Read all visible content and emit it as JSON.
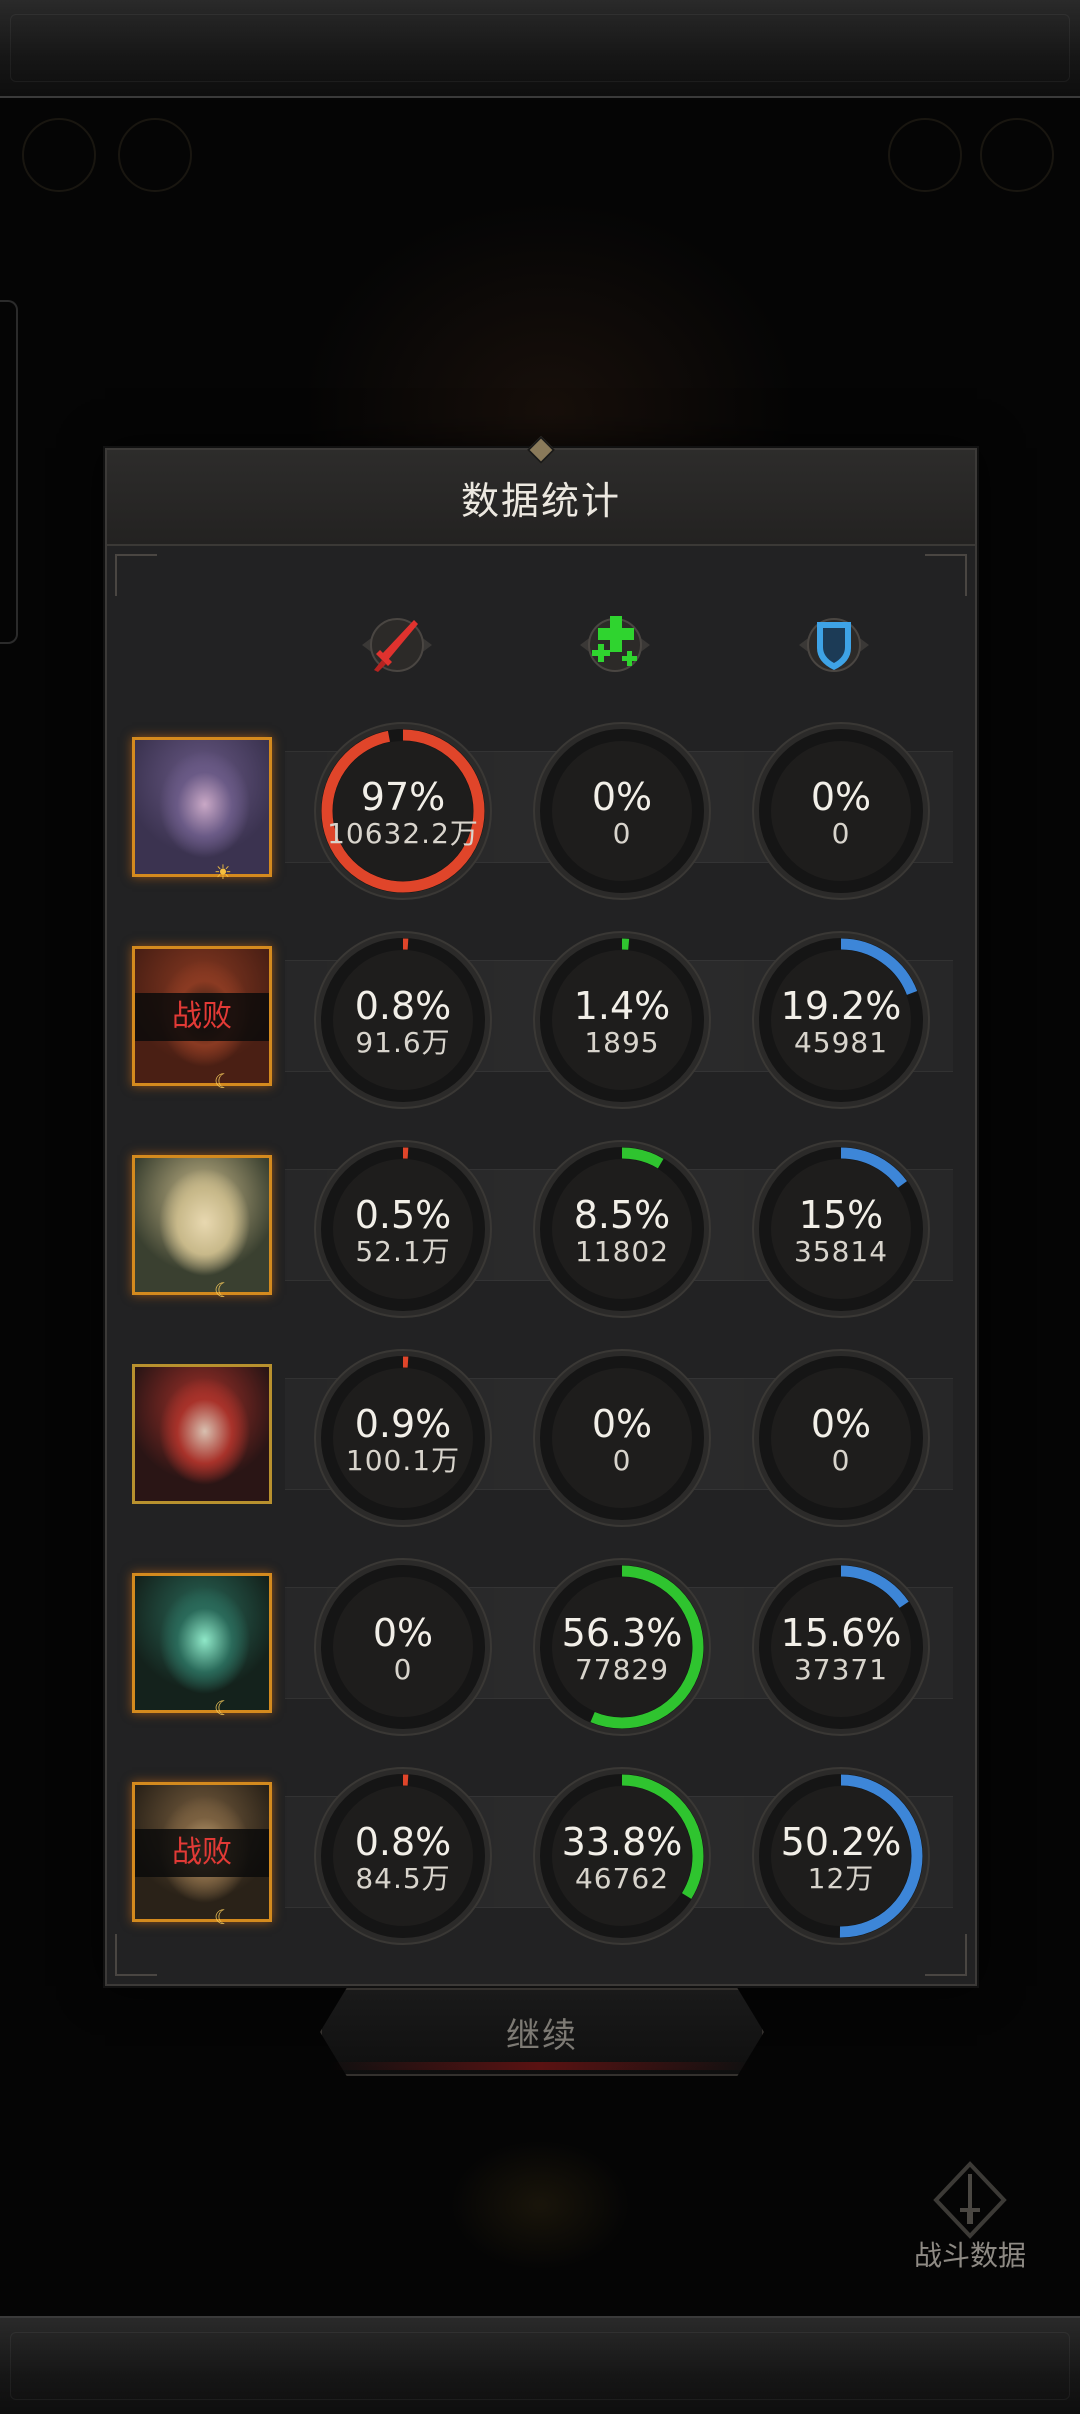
{
  "panel": {
    "title": "数据统计",
    "columns": [
      {
        "icon": "sword-damage-icon",
        "color": "#e0322e"
      },
      {
        "icon": "heal-plus-icon",
        "color": "#2fd42f"
      },
      {
        "icon": "shield-tank-icon",
        "color": "#3ea3e6"
      }
    ],
    "rows": [
      {
        "hero": "hero-1",
        "defeated_label": "",
        "badge": "sun-icon",
        "stats": [
          {
            "pct": "97%",
            "value": "10632.2万",
            "fraction": 0.97
          },
          {
            "pct": "0%",
            "value": "0",
            "fraction": 0
          },
          {
            "pct": "0%",
            "value": "0",
            "fraction": 0
          }
        ]
      },
      {
        "hero": "hero-2",
        "defeated_label": "战败",
        "badge": "moon-icon",
        "stats": [
          {
            "pct": "0.8%",
            "value": "91.6万",
            "fraction": 0.008
          },
          {
            "pct": "1.4%",
            "value": "1895",
            "fraction": 0.014
          },
          {
            "pct": "19.2%",
            "value": "45981",
            "fraction": 0.192
          }
        ]
      },
      {
        "hero": "hero-3",
        "defeated_label": "",
        "badge": "moon-icon",
        "stats": [
          {
            "pct": "0.5%",
            "value": "52.1万",
            "fraction": 0.005
          },
          {
            "pct": "8.5%",
            "value": "11802",
            "fraction": 0.085
          },
          {
            "pct": "15%",
            "value": "35814",
            "fraction": 0.15
          }
        ]
      },
      {
        "hero": "hero-4",
        "defeated_label": "",
        "badge": "",
        "stats": [
          {
            "pct": "0.9%",
            "value": "100.1万",
            "fraction": 0.009
          },
          {
            "pct": "0%",
            "value": "0",
            "fraction": 0
          },
          {
            "pct": "0%",
            "value": "0",
            "fraction": 0
          }
        ]
      },
      {
        "hero": "hero-5",
        "defeated_label": "",
        "badge": "moon-icon",
        "stats": [
          {
            "pct": "0%",
            "value": "0",
            "fraction": 0
          },
          {
            "pct": "56.3%",
            "value": "77829",
            "fraction": 0.563
          },
          {
            "pct": "15.6%",
            "value": "37371",
            "fraction": 0.156
          }
        ]
      },
      {
        "hero": "hero-6",
        "defeated_label": "战败",
        "badge": "moon-icon",
        "stats": [
          {
            "pct": "0.8%",
            "value": "84.5万",
            "fraction": 0.008
          },
          {
            "pct": "33.8%",
            "value": "46762",
            "fraction": 0.338
          },
          {
            "pct": "50.2%",
            "value": "12万",
            "fraction": 0.502
          }
        ]
      }
    ]
  },
  "continue_label": "继续",
  "battle_data_label": "战斗数据",
  "colors": {
    "damage": "#e0452a",
    "heal": "#2fc42f",
    "shield": "#3d86d8",
    "ring_track": "#151515",
    "defeat_text": "#e23a36"
  }
}
